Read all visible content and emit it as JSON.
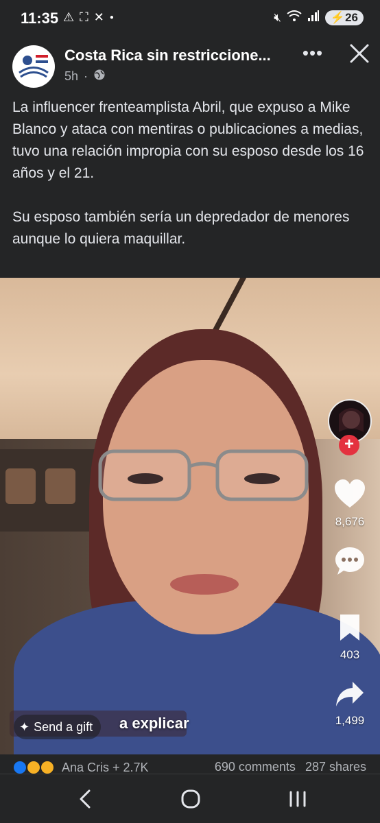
{
  "status_bar": {
    "time": "11:35",
    "battery": "26"
  },
  "post": {
    "page_name": "Costa Rica sin restriccione...",
    "time_ago": "5h",
    "paragraphs": [
      "La influencer frenteamplista Abril, que expuso a Mike Blanco y ataca con mentiras o publicaciones a medias, tuvo una relación impropia con su esposo desde los 16 años y el 21.",
      "Su esposo también sería un depredador de menores aunque lo quiera maquillar."
    ]
  },
  "video": {
    "caption_partial": "a explicar",
    "send_gift_label": "Send a gift",
    "likes": "8,676",
    "saves": "403",
    "shares_count": "1,499"
  },
  "reactions": {
    "names": "Ana Cris + 2.7K",
    "comments": "690 comments",
    "shares": "287 shares"
  },
  "colors": {
    "background": "#242526",
    "follow_red": "#e4323f",
    "text_secondary": "#b0b3b8"
  }
}
